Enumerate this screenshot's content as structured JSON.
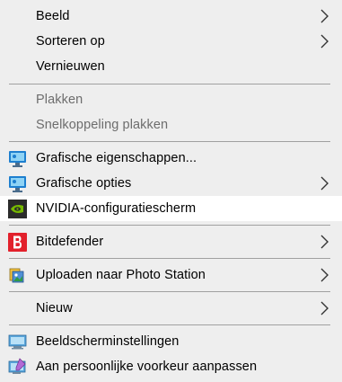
{
  "menu": {
    "items": [
      {
        "label": "Beeld",
        "submenu": true,
        "enabled": true,
        "icon": null
      },
      {
        "label": "Sorteren op",
        "submenu": true,
        "enabled": true,
        "icon": null
      },
      {
        "label": "Vernieuwen",
        "submenu": false,
        "enabled": true,
        "icon": null
      },
      {
        "label": "Plakken",
        "submenu": false,
        "enabled": false,
        "icon": null
      },
      {
        "label": "Snelkoppeling plakken",
        "submenu": false,
        "enabled": false,
        "icon": null
      },
      {
        "label": "Grafische eigenschappen...",
        "submenu": false,
        "enabled": true,
        "icon": "intel-graphics-icon"
      },
      {
        "label": "Grafische opties",
        "submenu": true,
        "enabled": true,
        "icon": "intel-graphics-icon"
      },
      {
        "label": "NVIDIA-configuratiescherm",
        "submenu": false,
        "enabled": true,
        "icon": "nvidia-icon",
        "highlighted": true
      },
      {
        "label": "Bitdefender",
        "submenu": true,
        "enabled": true,
        "icon": "bitdefender-icon"
      },
      {
        "label": "Uploaden naar Photo Station",
        "submenu": true,
        "enabled": true,
        "icon": "photo-station-icon"
      },
      {
        "label": "Nieuw",
        "submenu": true,
        "enabled": true,
        "icon": null
      },
      {
        "label": "Beeldscherminstellingen",
        "submenu": false,
        "enabled": true,
        "icon": "display-settings-icon"
      },
      {
        "label": "Aan persoonlijke voorkeur aanpassen",
        "submenu": false,
        "enabled": true,
        "icon": "personalize-icon"
      }
    ]
  },
  "colors": {
    "menu_background": "#eeeeee",
    "highlight_background": "#ffffff",
    "disabled_text": "#6d6d6d",
    "separator": "#a0a0a0",
    "bitdefender_red": "#e2202b",
    "nvidia_green": "#76b900"
  }
}
